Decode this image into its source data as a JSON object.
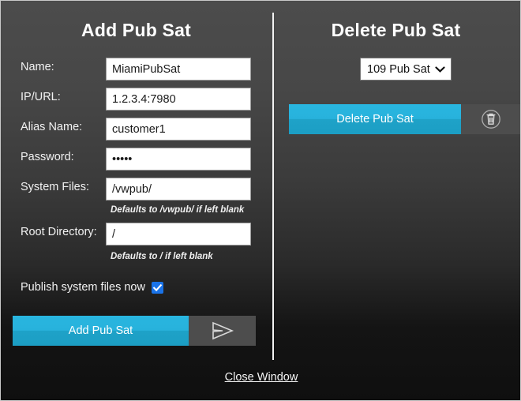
{
  "window": {
    "background_top": "#4c4c4c",
    "background_bottom": "#0f0f0f",
    "border_color": "#c9c9c9"
  },
  "add_panel": {
    "title": "Add Pub Sat",
    "fields": [
      {
        "label": "Name:",
        "value": "MiamiPubSat",
        "placeholder": "",
        "type": "text"
      },
      {
        "label": "IP/URL:",
        "value": "1.2.3.4:7980",
        "placeholder": "",
        "type": "text"
      },
      {
        "label": "Alias Name:",
        "value": "customer1",
        "placeholder": "",
        "type": "text"
      },
      {
        "label": "Password:",
        "value": "•••••",
        "placeholder": "",
        "type": "password"
      },
      {
        "label": "System Files:",
        "value": "/vwpub/",
        "placeholder": "",
        "type": "text"
      },
      {
        "label": "Root Directory:",
        "value": "/",
        "placeholder": "",
        "type": "text"
      }
    ],
    "hints": {
      "system_files": "Defaults to /vwpub/ if left blank",
      "root_directory": "Defaults to / if left blank"
    },
    "publish_checkbox": {
      "label": "Publish system files now",
      "checked": true,
      "color": "#1a73e8"
    },
    "submit": {
      "label": "Add Pub Sat",
      "icon": "send-icon",
      "accent": "#29b6e0"
    }
  },
  "delete_panel": {
    "title": "Delete Pub Sat",
    "select": {
      "selected": "109 Pub Sat",
      "options": [
        "109 Pub Sat"
      ],
      "icon": "chevron-down-icon"
    },
    "submit": {
      "label": "Delete Pub Sat",
      "icon": "trash-icon",
      "accent": "#29b6e0"
    }
  },
  "footer": {
    "close_label": "Close Window"
  }
}
